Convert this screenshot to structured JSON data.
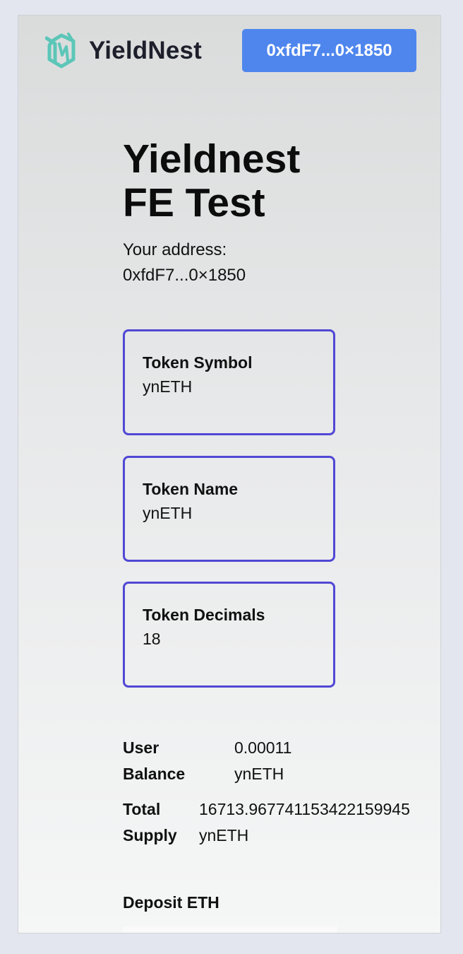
{
  "header": {
    "brand": "YieldNest",
    "wallet_button": "0xfdF7...0×1850"
  },
  "main": {
    "title": "Yieldnest FE Test",
    "address_label": "Your address:",
    "address_value": "0xfdF7...0×1850",
    "cards": [
      {
        "label": "Token Symbol",
        "value": "ynETH"
      },
      {
        "label": "Token Name",
        "value": "ynETH"
      },
      {
        "label": "Token Decimals",
        "value": "18"
      }
    ],
    "user_balance": {
      "label": "User Balance",
      "value": "0.00011 ynETH"
    },
    "total_supply": {
      "label": "Total Supply",
      "value": "16713.967741153422159945 ynETH"
    },
    "deposit_label": "Deposit ETH"
  },
  "colors": {
    "accent": "#4e86ee",
    "card_border": "#5048d5",
    "logo": "#5cc6b8"
  },
  "icons": {
    "logo": "yieldnest-logo-icon"
  }
}
